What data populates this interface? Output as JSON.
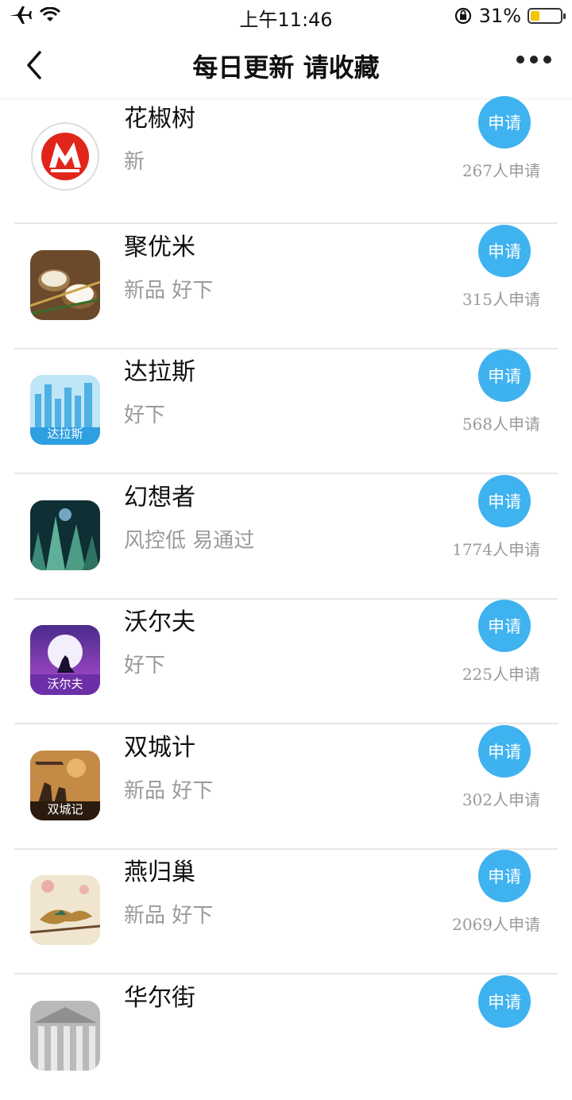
{
  "status_bar": {
    "time": "上午11:46",
    "battery_percent_text": "31%",
    "battery_level": 0.31,
    "battery_color": "#f2c500"
  },
  "nav": {
    "title": "每日更新 请收藏",
    "back_icon": "chevron-left-icon",
    "more_icon": "more-dots-icon"
  },
  "accent_color": "#3fb2f0",
  "apps": [
    {
      "name": "花椒树",
      "desc": "新",
      "button": "申请",
      "count": "267人申请",
      "icon": "cmb-logo-icon"
    },
    {
      "name": "聚优米",
      "desc": "新品 好下",
      "button": "申请",
      "count": "315人申请",
      "icon": "rice-icon"
    },
    {
      "name": "达拉斯",
      "desc": "好下",
      "button": "申请",
      "count": "568人申请",
      "icon": "city-skyline-icon",
      "icon_text": "达拉斯"
    },
    {
      "name": "幻想者",
      "desc": "风控低 易通过",
      "button": "申请",
      "count": "1774人申请",
      "icon": "fantasy-forest-icon"
    },
    {
      "name": "沃尔夫",
      "desc": "好下",
      "button": "申请",
      "count": "225人申请",
      "icon": "wolf-moon-icon",
      "icon_text": "沃尔夫"
    },
    {
      "name": "双城计",
      "desc": "新品 好下",
      "button": "申请",
      "count": "302人申请",
      "icon": "soldiers-icon",
      "icon_text": "双城记"
    },
    {
      "name": "燕归巢",
      "desc": "新品 好下",
      "button": "申请",
      "count": "2069人申请",
      "icon": "birds-painting-icon"
    },
    {
      "name": "华尔街",
      "desc": "",
      "button": "申请",
      "count": "",
      "icon": "building-columns-icon"
    }
  ]
}
